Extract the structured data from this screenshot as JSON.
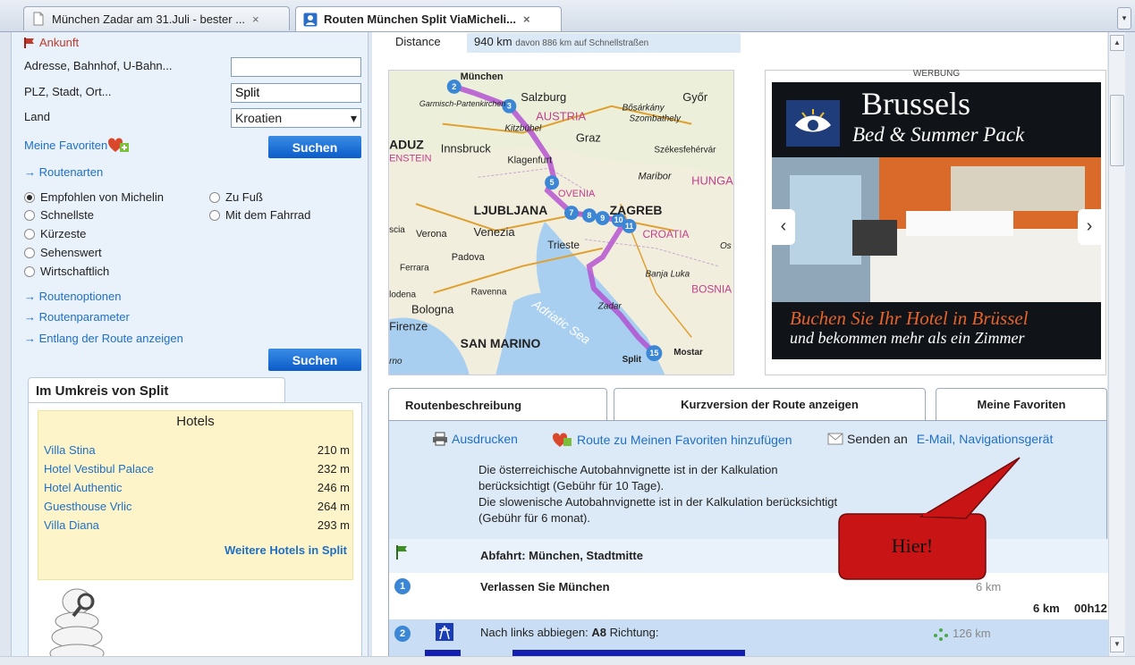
{
  "browser": {
    "tabs": [
      {
        "title": "München Zadar am 31.Juli - bester ...",
        "close": "×"
      },
      {
        "title": "Routen München Split ViaMicheli...",
        "close": "×"
      }
    ],
    "tab_menu": "▾"
  },
  "form": {
    "arrival_label": "Ankunft",
    "address_label": "Adresse, Bahnhof, U-Bahn...",
    "address_value": "",
    "city_label": "PLZ, Stadt, Ort...",
    "city_value": "Split",
    "country_label": "Land",
    "country_value": "Kroatien",
    "favorites_label": "Meine Favoriten",
    "search_label": "Suchen",
    "route_types_link": "Routenarten",
    "route_types": [
      {
        "label": "Empfohlen von Michelin",
        "selected": true
      },
      {
        "label": "Zu Fuß",
        "selected": false
      },
      {
        "label": "Schnellste",
        "selected": false
      },
      {
        "label": "Mit dem Fahrrad",
        "selected": false
      },
      {
        "label": "Kürzeste",
        "selected": false
      },
      {
        "label": "Sehenswert",
        "selected": false
      },
      {
        "label": "Wirtschaftlich",
        "selected": false
      }
    ],
    "route_options_link": "Routenoptionen",
    "route_params_link": "Routenparameter",
    "along_route_link": "Entlang der Route anzeigen",
    "search2_label": "Suchen"
  },
  "nearby": {
    "tab_title": "Im Umkreis von Split",
    "hotels_title": "Hotels",
    "hotels": [
      {
        "name": "Villa Stina",
        "dist": "210 m"
      },
      {
        "name": "Hotel Vestibul Palace",
        "dist": "232 m"
      },
      {
        "name": "Hotel Authentic",
        "dist": "246 m"
      },
      {
        "name": "Guesthouse Vrlic",
        "dist": "264 m"
      },
      {
        "name": "Villa Diana",
        "dist": "293 m"
      }
    ],
    "more_hotels": "Weitere Hotels in Split"
  },
  "summary": {
    "distance_label": "Distance",
    "distance_value": "940 km",
    "distance_note": "davon 886 km auf Schnellstraßen"
  },
  "map": {
    "labels": [
      "München",
      "Salzburg",
      "Győr",
      "Garmisch-Partenkirchen",
      "AUSTRIA",
      "Bősárkány",
      "Szombathely",
      "Kitzbühel",
      "Graz",
      "ADUZ",
      "Innsbruck",
      "Székesfehérvár",
      "Klagenfurt",
      "Maribor",
      "HUNGA",
      "LJUBLJANA",
      "OVENIA",
      "ZAGREB",
      "scia",
      "Verona",
      "Venezia",
      "CROATIA",
      "Trieste",
      "Os",
      "Padova",
      "Ferrara",
      "Banja Luka",
      "lodena",
      "Ravenna",
      "BOSNIA AND HERZEGOV",
      "Bologna",
      "Adriatic Sea",
      "Zadar",
      "Firenze",
      "SAN MARINO",
      "Split",
      "Mostar",
      "rno",
      "ENSTEIN"
    ],
    "markers": [
      "2",
      "3",
      "5",
      "7",
      "8",
      "9",
      "10",
      "11",
      "15"
    ]
  },
  "ad": {
    "werbung": "WERBUNG",
    "title": "Brussels",
    "subtitle": "Bed & Summer Pack",
    "line1": "Buchen Sie Ihr Hotel in Brüssel",
    "line2": "und bekommen mehr  als  ein Zimmer",
    "prev": "‹",
    "next": "›"
  },
  "route_tabs": [
    {
      "label": "Routenbeschreibung"
    },
    {
      "label": "Kurzversion der Route anzeigen"
    },
    {
      "label": "Meine Favoriten"
    }
  ],
  "actions": {
    "print": "Ausdrucken",
    "add_fav": "Route zu Meinen Favoriten hinzufügen",
    "send_label": "Senden an",
    "email": "E-Mail",
    "sep": ",",
    "navi": "Navigationsgerät"
  },
  "vignette": {
    "line1": "Die österreichische Autobahnvignette ist in der Kalkulation",
    "line2": "berücksichtigt (Gebühr für 10 Tage).",
    "line3": "Die slowenische Autobahnvignette ist in der Kalkulation berücksichtigt",
    "line4": "(Gebühr für 6 monat)."
  },
  "steps": {
    "departure": "Abfahrt: München, Stadtmitte",
    "step1_num": "1",
    "step1_text": "Verlassen Sie München",
    "step1_dist": "6 km",
    "step1_total_dist": "6 km",
    "step1_time": "00h12",
    "step2_num": "2",
    "step2_prefix": "Nach links abbiegen:",
    "step2_road": "A8",
    "step2_suffix": "Richtung:",
    "step2_dist": "126 km"
  },
  "callout": {
    "text": "Hier!"
  },
  "colors": {
    "link": "#1f6fc5",
    "button": "#0b5cc8",
    "callout_fill": "#c81414",
    "ad_accent": "#e8622a"
  }
}
